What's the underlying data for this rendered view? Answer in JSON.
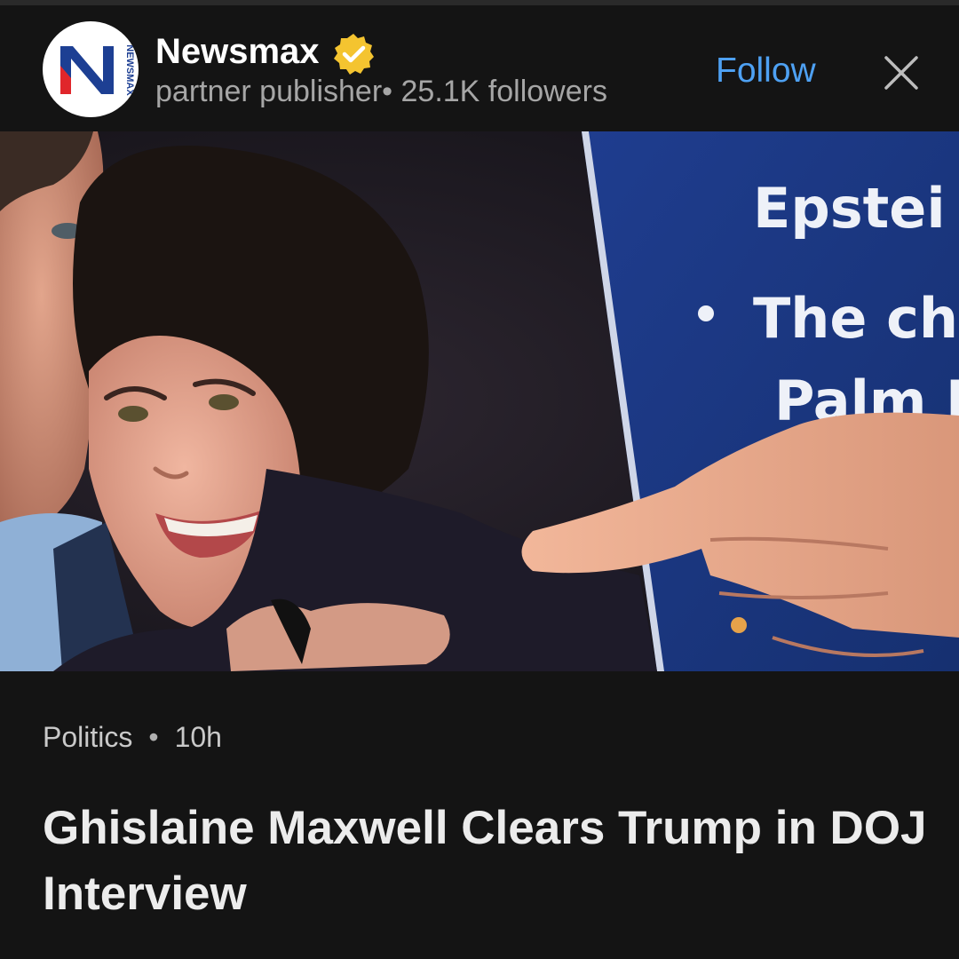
{
  "publisher": {
    "logo_text": "N",
    "logo_subtext": "NEWSMAX",
    "name": "Newsmax",
    "subtitle": "partner publisher• 25.1K followers"
  },
  "actions": {
    "follow_label": "Follow"
  },
  "hero": {
    "board_words": [
      "Epstei",
      "The ch",
      "Palm B"
    ]
  },
  "article": {
    "category": "Politics",
    "separator": "•",
    "age": "10h",
    "headline": "Ghislaine Maxwell Clears Trump in DOJ Interview"
  },
  "colors": {
    "background": "#141414",
    "accent": "#4ea1f3",
    "verified_badge": "#f4c430",
    "logo_blue": "#1d3f93",
    "logo_red": "#e0262b"
  },
  "icons": {
    "verified": "verified-badge-icon",
    "close": "close-icon"
  }
}
